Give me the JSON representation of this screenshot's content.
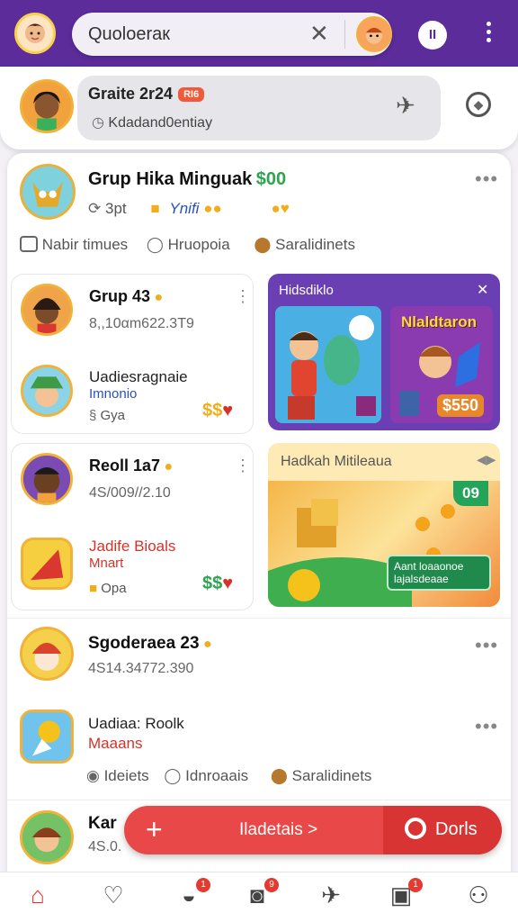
{
  "topbar": {
    "search_value": "Quoloeraк",
    "clear_icon": "close-icon",
    "pause_label": "II"
  },
  "profile": {
    "name": "Graite 2r24",
    "badge": "RI6",
    "subtitle": "Kdadand0entiay"
  },
  "post1": {
    "title": "Grup Hika Minguak",
    "amount": "$00",
    "stat1": "3pt",
    "stat2": "Ynifi"
  },
  "actions": {
    "a1": "Nabir timues",
    "a2": "Hruopoia",
    "a3": "Saralidinets"
  },
  "card1": {
    "title": "Grup 43",
    "value": "8,,10αm622.3T9",
    "item_title": "Uadiesragnaie",
    "item_sub": "Imnonio",
    "item_stat": "Gya",
    "item_money": "$$"
  },
  "card2": {
    "title": "Reoll 1a7",
    "value": "4S/009//2.10",
    "item_title": "Jadife Bioals",
    "item_sub": "Mnart",
    "item_stat": "Opa",
    "item_money": "$$"
  },
  "promo1": {
    "title": "Hidsdiklo",
    "price": "$550",
    "banner": "Nlaldtaron"
  },
  "promo2": {
    "title": "Hadkah Mitileaua",
    "tag": "09",
    "cta1": "Aant loaaonoe",
    "cta2": "lajalsdeaae"
  },
  "post3": {
    "title": "Sgoderaea 23",
    "value": "4S14.34772.390"
  },
  "post4": {
    "title": "Uadiaa: Roolk",
    "sub": "Maaans"
  },
  "actions2": {
    "a1": "Ideiets",
    "a2": "Idnroaais",
    "a3": "Saralidinets"
  },
  "post5": {
    "title": "Kar",
    "value": "4S.0."
  },
  "fab": {
    "plus": "+",
    "label": "Iladetais >",
    "right": "Dorls"
  },
  "nav": {
    "badge1": "1",
    "badge2": "9",
    "badge3": "1"
  },
  "colors": {
    "brand": "#5b2c9a",
    "accent": "#e94848",
    "gold": "#f1ae1c"
  }
}
